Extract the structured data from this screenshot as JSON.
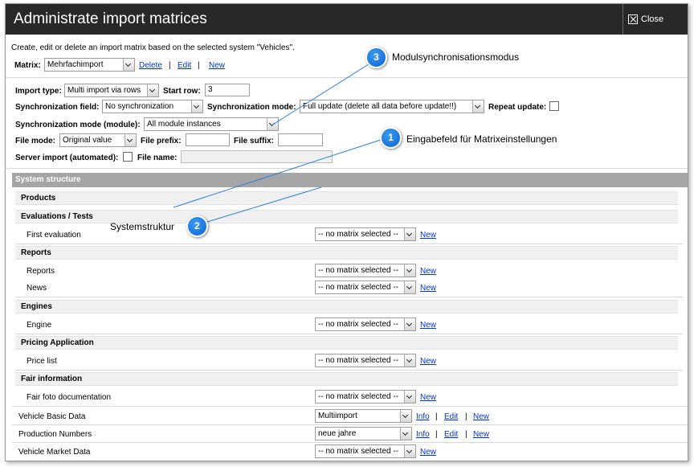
{
  "window": {
    "title": "Administrate import matrices",
    "close_label": "Close"
  },
  "intro": "Create, edit or delete an import matrix based on the selected system \"Vehicles\".",
  "matrix": {
    "label": "Matrix:",
    "value": "Mehrfachimport",
    "delete": "Delete",
    "edit": "Edit",
    "new": "New",
    "sep": "|"
  },
  "settings": {
    "import_type_label": "Import type:",
    "import_type_value": "Multi import via rows",
    "start_row_label": "Start row:",
    "start_row_value": "3",
    "sync_field_label": "Synchronization field:",
    "sync_field_value": "No synchronization",
    "sync_mode_label": "Synchronization mode:",
    "sync_mode_value": "Full update (delete all data before update!!)",
    "repeat_update_label": "Repeat update:",
    "sync_module_label": "Synchronization mode (module):",
    "sync_module_value": "All module instances",
    "file_mode_label": "File mode:",
    "file_mode_value": "Original value",
    "file_prefix_label": "File prefix:",
    "file_suffix_label": "File suffix:",
    "server_import_label": "Server import (automated):",
    "file_name_label": "File name:"
  },
  "system_structure": {
    "title": "System structure",
    "no_matrix": "-- no matrix selected --",
    "new": "New",
    "info": "Info",
    "edit": "Edit",
    "sep": "|",
    "groups": [
      {
        "name": "Products"
      },
      {
        "name": "Evaluations / Tests",
        "items": [
          "First evaluation"
        ]
      },
      {
        "name": "Reports",
        "items": [
          "Reports",
          "News"
        ]
      },
      {
        "name": "Engines",
        "items": [
          "Engine"
        ]
      },
      {
        "name": "Pricing Application",
        "items": [
          "Price list"
        ]
      },
      {
        "name": "Fair information",
        "items": [
          "Fair foto documentation"
        ]
      }
    ],
    "top_rows": [
      {
        "label": "Vehicle Basic Data",
        "value": "Multiimport"
      },
      {
        "label": "Production Numbers",
        "value": "neue jahre"
      },
      {
        "label": "Vehicle Market Data",
        "value": "-- no matrix selected --"
      }
    ]
  },
  "callouts": [
    {
      "number": "1",
      "label": "Eingabefeld für Matrixeinstellungen"
    },
    {
      "number": "2",
      "label": "Systemstruktur"
    },
    {
      "number": "3",
      "label": "Modulsynchronisationsmodus"
    }
  ],
  "colors": {
    "titlebar": "#282828",
    "section_header": "#a5a5a5",
    "link": "#0033cc",
    "callout": "#0b5fd4"
  }
}
